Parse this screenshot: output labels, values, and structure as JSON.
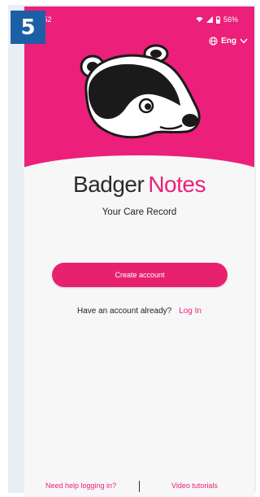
{
  "step_badge": "5",
  "status_bar": {
    "time": "4:52",
    "battery": "56%"
  },
  "language": {
    "label": "Eng",
    "icon": "globe-icon"
  },
  "app": {
    "logo_part1": "Badger",
    "logo_part2": "Notes",
    "tagline": "Your Care Record"
  },
  "actions": {
    "create_account": "Create account",
    "have_account": "Have an account already?",
    "login": "Log In"
  },
  "footer": {
    "help": "Need help logging in?",
    "video": "Video tutorials"
  },
  "colors": {
    "brand_pink": "#ec1f7a",
    "step_badge_blue": "#1d5fa5"
  }
}
